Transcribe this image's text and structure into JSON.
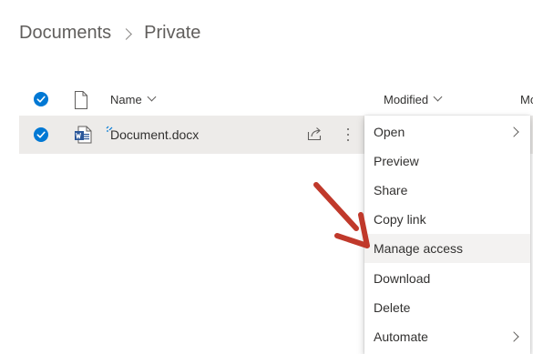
{
  "breadcrumb": {
    "root": "Documents",
    "current": "Private"
  },
  "columns": {
    "name": "Name",
    "modified": "Modified",
    "modified_by": "Mo"
  },
  "file": {
    "name": "Document.docx",
    "type_icon": "word-document-icon",
    "selected": true
  },
  "context_menu": {
    "items": [
      {
        "label": "Open",
        "has_submenu": true
      },
      {
        "label": "Preview",
        "has_submenu": false
      },
      {
        "label": "Share",
        "has_submenu": false
      },
      {
        "label": "Copy link",
        "has_submenu": false
      },
      {
        "label": "Manage access",
        "has_submenu": false,
        "highlighted": true
      },
      {
        "label": "Download",
        "has_submenu": false
      },
      {
        "label": "Delete",
        "has_submenu": false
      },
      {
        "label": "Automate",
        "has_submenu": true
      }
    ]
  },
  "colors": {
    "accent": "#0078d4",
    "row_selected": "#edebe9",
    "menu_hover": "#f3f2f1",
    "arrow": "#c0392b",
    "word_blue": "#2b579a"
  }
}
